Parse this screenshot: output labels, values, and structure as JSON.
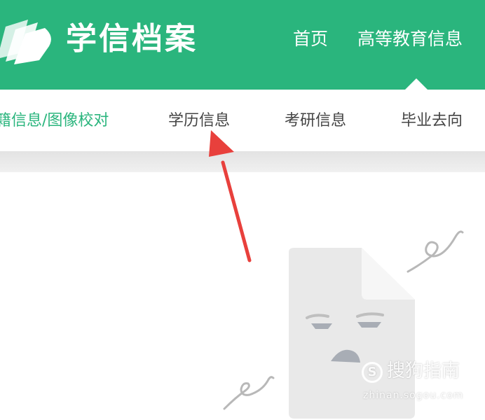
{
  "header": {
    "brand": "学信档案",
    "logo_icon": "book-pages-icon",
    "background_color": "#2ab57d",
    "nav": [
      {
        "label": "首页"
      },
      {
        "label": "高等教育信息",
        "active": true
      }
    ]
  },
  "subnav": {
    "items": [
      {
        "label": "籍信息/图像校对",
        "active": true
      },
      {
        "label": "学历信息"
      },
      {
        "label": "考研信息"
      },
      {
        "label": "毕业去向"
      }
    ],
    "active_color": "#2ab57d"
  },
  "annotation": {
    "icon": "red-arrow-icon",
    "color": "#e8403c"
  },
  "empty_state": {
    "icon": "unamused-document-icon"
  },
  "watermark": {
    "text": "搜狗指南",
    "url": "zhinan.sogou.com"
  }
}
